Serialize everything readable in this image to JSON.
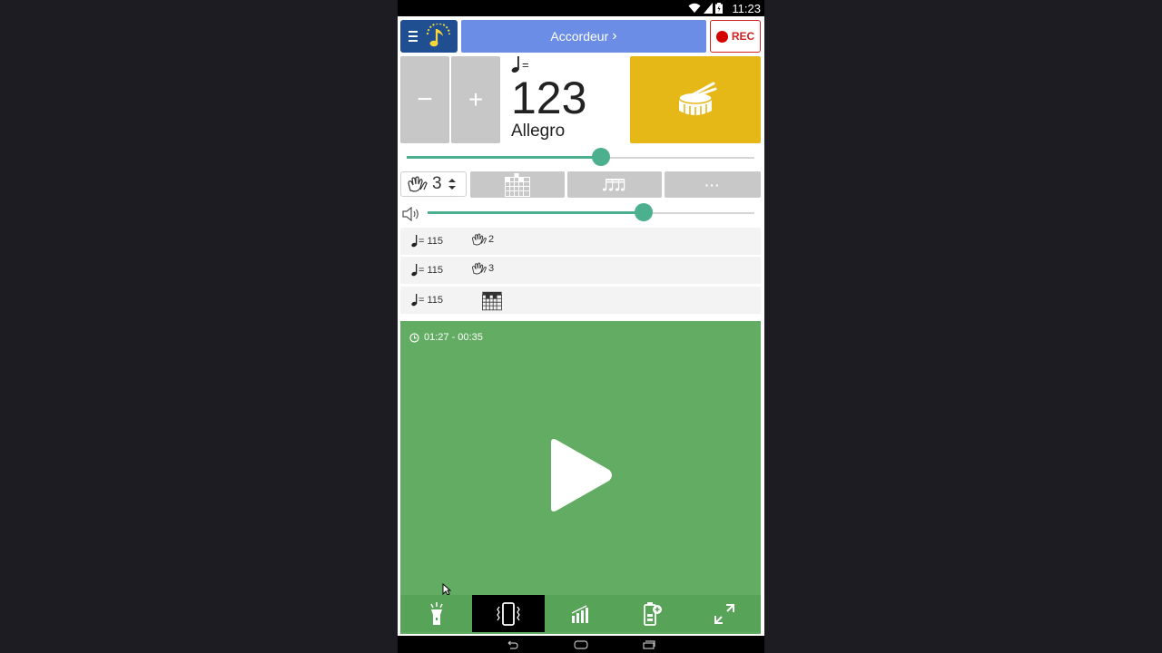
{
  "status_bar": {
    "time": "11:23"
  },
  "toolbar": {
    "menu_icon": "hamburger-menu-icon",
    "logo_icon": "metronome-note-logo-icon",
    "tuner_label": "Accordeur",
    "tuner_chevron": "›",
    "rec_label": "REC"
  },
  "tempo": {
    "minus_label": "−",
    "plus_label": "+",
    "equals": "=",
    "value": "123",
    "name": "Allegro",
    "slider_level": 0.56
  },
  "options": {
    "beats_value": "3",
    "more_label": "···"
  },
  "volume": {
    "level": 0.66
  },
  "presets": [
    {
      "equals": "= 115",
      "icon": "clap-hands-icon",
      "value": "2"
    },
    {
      "equals": "= 115",
      "icon": "clap-hands-icon",
      "value": "3"
    },
    {
      "equals": "= 115",
      "icon": "grid-pattern-icon",
      "value": ""
    }
  ],
  "player": {
    "timer": "01:27 - 00:35",
    "play_icon": "play-icon"
  },
  "bottom_bar": [
    "flashlight-icon",
    "vibrate-phone-icon",
    "signal-bars-icon",
    "battery-plus-icon",
    "fullscreen-icon"
  ],
  "colors": {
    "menu_bg": "#1f4f91",
    "tuner_bg": "#6b8de6",
    "rec_red": "#d40000",
    "drum_yellow": "#e6b817",
    "slider_green": "#4caf8d",
    "player_green": "#63ac63"
  }
}
